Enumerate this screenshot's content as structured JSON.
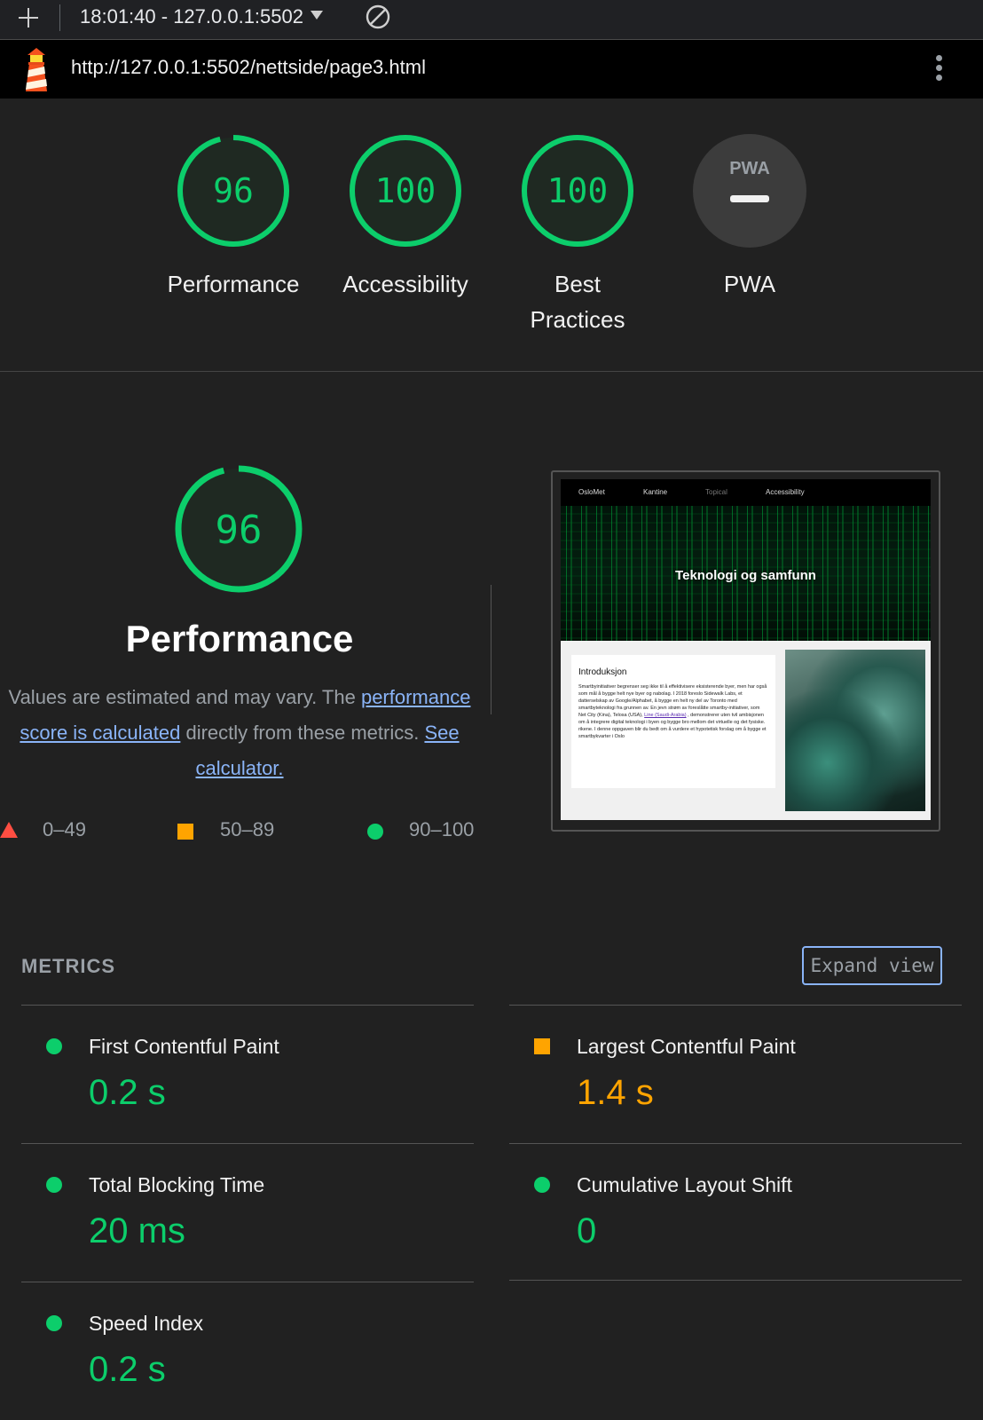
{
  "toolbar": {
    "report_select": "18:01:40 - 127.0.0.1:5502"
  },
  "urlbar": {
    "url": "http://127.0.0.1:5502/nettside/page3.html"
  },
  "scores": [
    {
      "value": "96",
      "label": "Performance",
      "fraction": 0.96
    },
    {
      "value": "100",
      "label": "Accessibility",
      "fraction": 1.0
    },
    {
      "value": "100",
      "label_line1": "Best",
      "label_line2": "Practices",
      "fraction": 1.0
    },
    {
      "badge": "PWA",
      "label": "PWA"
    }
  ],
  "performance": {
    "score": "96",
    "fraction": 0.96,
    "title": "Performance",
    "desc_prefix": "Values are estimated and may vary. The ",
    "desc_link1": "performance score is calculated",
    "desc_middle": " directly from these metrics. ",
    "desc_link2": "See calculator."
  },
  "legend": {
    "fail": "0–49",
    "average": "50–89",
    "pass": "90–100"
  },
  "thumbnail": {
    "nav": [
      "OsloMet",
      "Kantine",
      "Topical",
      "Accessibility"
    ],
    "hero_title": "Teknologi og samfunn",
    "card_title": "Introduksjon",
    "card_text_before": "Smartbyinitiativer begrenser seg ikke til å effektivisere eksisterende byer, men har også som mål å bygge helt nye byer og nabolag. I 2018 foreslo Sidewalk Labs, et datterselskap av Google/Alphabet, å bygge en helt ny del av Toronto med smartbyteknologi fra grunnen av. En jevn strøm av foreslåtte smartby-initiativer, som Net City (Kina), Telosa (USA), ",
    "card_text_link": "Line (Saudi-Arabia)",
    "card_text_after": " , demonstrerer uten tvil ambisjonen om å integrere digital teknologi i byen og bygge bro mellom det virtuelle og det fysiske. rikene. I denne oppgaven blir du bedt om å vurdere et hypotetisk forslag om å bygge et smartbykvarter i Oslo"
  },
  "metrics": {
    "title": "METRICS",
    "expand_label": "Expand view",
    "items": [
      {
        "name": "First Contentful Paint",
        "value": "0.2 s",
        "rating": "pass"
      },
      {
        "name": "Largest Contentful Paint",
        "value": "1.4 s",
        "rating": "average"
      },
      {
        "name": "Total Blocking Time",
        "value": "20 ms",
        "rating": "pass"
      },
      {
        "name": "Cumulative Layout Shift",
        "value": "0",
        "rating": "pass"
      },
      {
        "name": "Speed Index",
        "value": "0.2 s",
        "rating": "pass"
      }
    ]
  },
  "colors": {
    "pass": "#0cce6b",
    "average": "#ffa400",
    "fail": "#ff4e42",
    "link": "#8ab4f8"
  },
  "icons": {
    "new_report": "plus-icon",
    "clear": "block-icon",
    "logo": "lighthouse-icon",
    "menu": "kebab-menu-icon"
  }
}
